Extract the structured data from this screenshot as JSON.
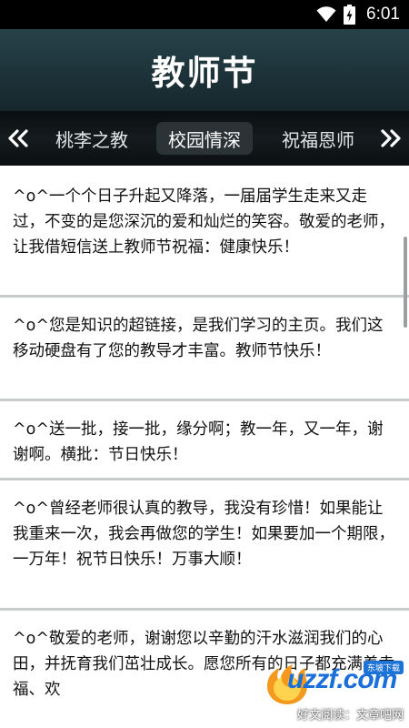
{
  "status_bar": {
    "time": "6:01",
    "battery_level": "6",
    "icons": [
      "wifi-icon",
      "battery-charging-icon"
    ]
  },
  "header": {
    "title": "教师节"
  },
  "tabs": {
    "prev_icon": "double-chevron-left-icon",
    "next_icon": "double-chevron-right-icon",
    "items": [
      {
        "label": "桃李之教"
      },
      {
        "label": "校园情深",
        "selected": true
      },
      {
        "label": "祝福恩师"
      }
    ]
  },
  "messages": [
    {
      "text": "^o^一个个日子升起又降落，一届届学生走来又走过，不变的是您深沉的爱和灿烂的笑容。敬爱的老师，让我借短信送上教师节祝福：健康快乐！"
    },
    {
      "text": "^o^您是知识的超链接，是我们学习的主页。我们这移动硬盘有了您的教导才丰富。教师节快乐！"
    },
    {
      "text": "^o^送一批，接一批，缘分啊；教一年，又一年，谢谢啊。横批：节日快乐！"
    },
    {
      "text": "^o^曾经老师很认真的教导，我没有珍惜！如果能让我重来一次，我会再做您的学生！如果要加一个期限，一万年！祝节日快乐！万事大顺！"
    },
    {
      "text": "^o^敬爱的老师，谢谢您以辛勤的汗水滋润我们的心田，并抚育我们茁壮成长。愿您所有的日子都充满着幸福、欢"
    }
  ],
  "watermark": {
    "logo": "uzzf.com",
    "badge": "东坡下载",
    "caption": "好文阅读：文章吧网"
  },
  "colors": {
    "title_bar": "#1d3339",
    "tab_bar": "#111618",
    "selected_tab": "#2b3336",
    "divider": "#c8cccc",
    "logo_blue": "#1a6fd8"
  }
}
